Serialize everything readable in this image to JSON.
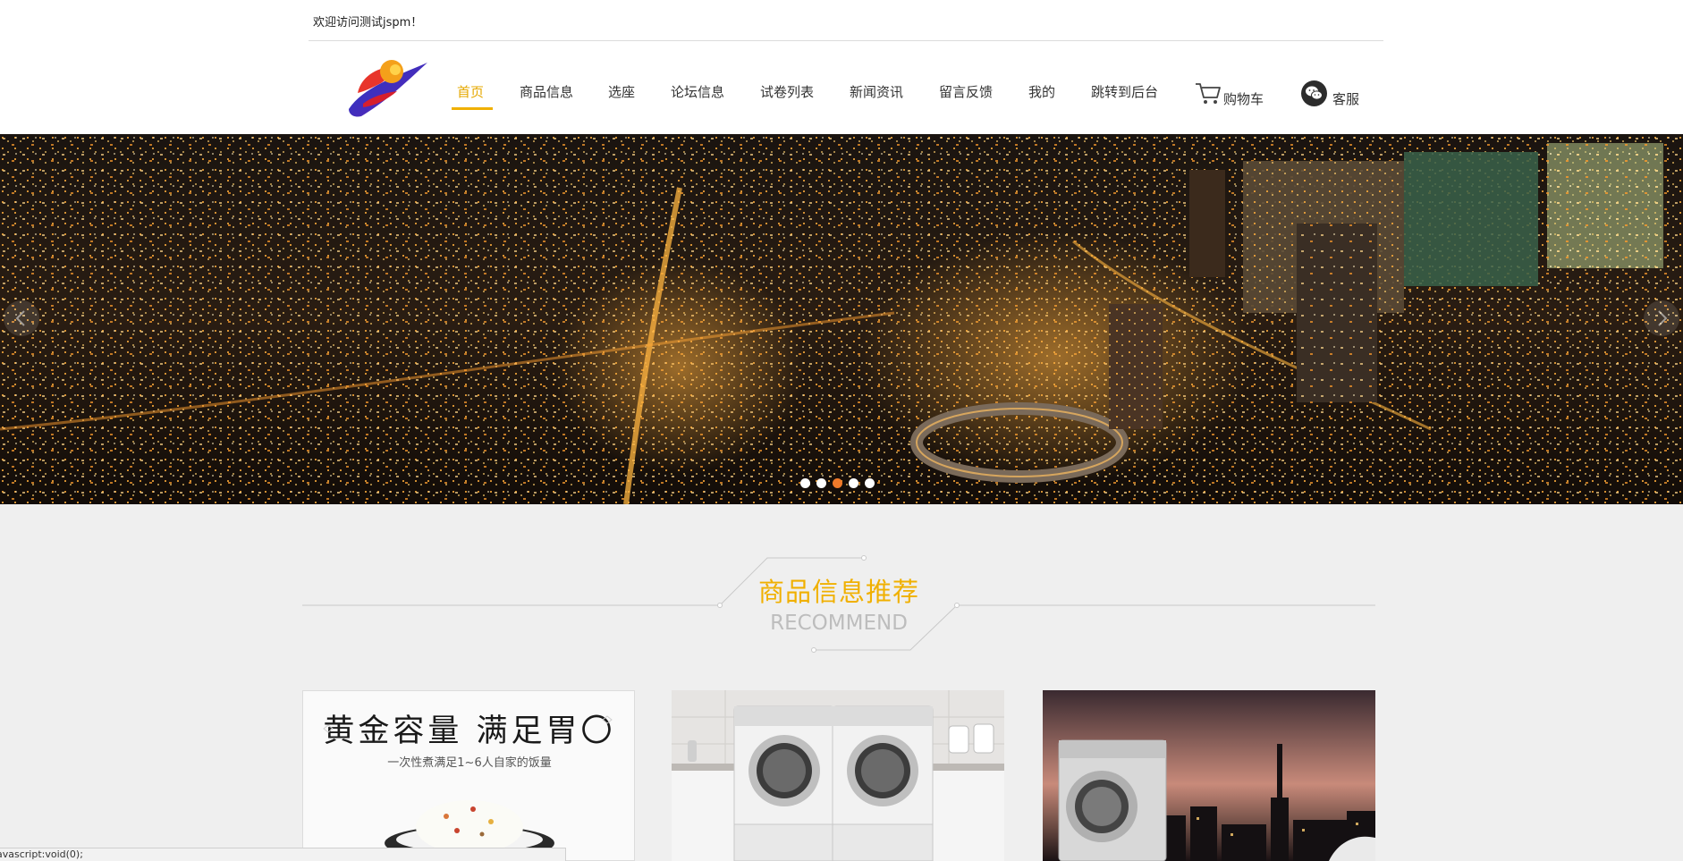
{
  "header": {
    "welcome": "欢迎访问测试jspm！"
  },
  "nav": {
    "items": [
      {
        "label": "首页",
        "active": true
      },
      {
        "label": "商品信息"
      },
      {
        "label": "选座"
      },
      {
        "label": "论坛信息"
      },
      {
        "label": "试卷列表"
      },
      {
        "label": "新闻资讯"
      },
      {
        "label": "留言反馈"
      },
      {
        "label": "我的"
      },
      {
        "label": "跳转到后台"
      }
    ],
    "cart_label": "购物车",
    "cart_icon": "shopping-cart-icon",
    "service_label": "客服",
    "service_icon": "wechat-icon",
    "accent_color": "#f0b000"
  },
  "banner": {
    "slide_count": 5,
    "active_slide": 3,
    "active_dot_color": "#f07a2a"
  },
  "section": {
    "title_cn": "商品信息推荐",
    "title_en": "RECOMMEND"
  },
  "products": [
    {
      "headline": "黄金容量 满足胃〇",
      "subtitle": "一次性煮满足1~6人自家的饭量"
    },
    {
      "headline": "",
      "subtitle": ""
    },
    {
      "headline": "",
      "subtitle": ""
    }
  ],
  "status_bar": {
    "text": "avascript:void(0);"
  }
}
